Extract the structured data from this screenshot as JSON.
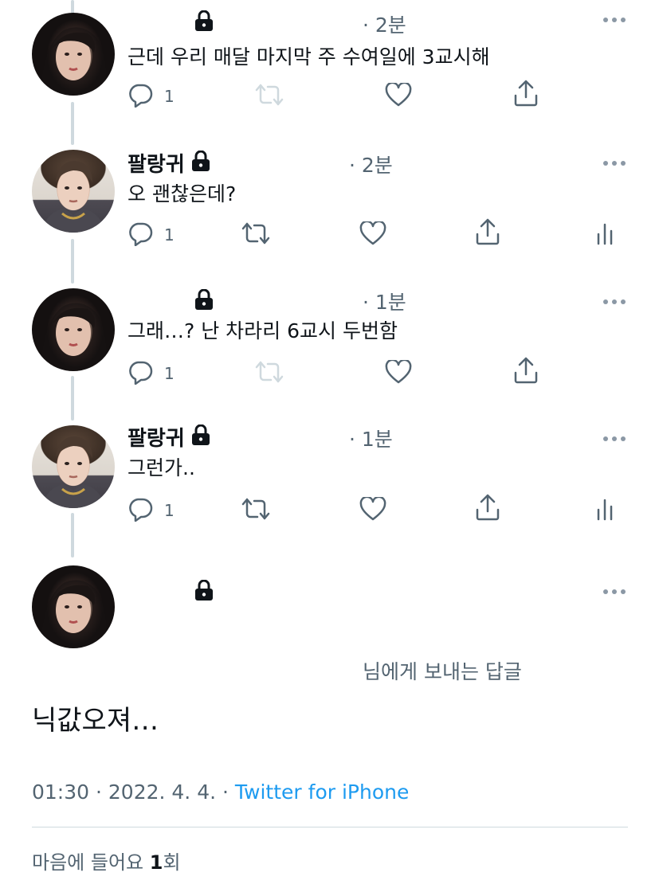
{
  "thread": [
    {
      "author": "",
      "locked": true,
      "time": "· 2분",
      "text": "근데 우리 매달 마지막 주 수여일에 3교시해",
      "reply_count": "1",
      "avatar": "girl"
    },
    {
      "author": "팔랑귀",
      "locked": true,
      "time": "· 2분",
      "text": "오 괜찮은데?",
      "reply_count": "1",
      "avatar": "boy"
    },
    {
      "author": "",
      "locked": true,
      "time": "· 1분",
      "text": "그래…? 난 차라리 6교시 두번함",
      "reply_count": "1",
      "avatar": "girl"
    },
    {
      "author": "팔랑귀",
      "locked": true,
      "time": "· 1분",
      "text": "그런가..",
      "reply_count": "1",
      "avatar": "boy"
    }
  ],
  "main_tweet": {
    "reply_to": "님에게 보내는 답글",
    "text": "닉값오져…",
    "timestamp": "01:30 · 2022. 4. 4. · ",
    "source": "Twitter for iPhone",
    "likes_label": "마음에 들어요 ",
    "likes_count": "1",
    "likes_suffix": "회"
  },
  "icons": {
    "reply": "reply-icon",
    "retweet": "retweet-icon",
    "like": "heart-icon",
    "share": "share-icon",
    "analytics": "analytics-icon",
    "more": "more-icon",
    "lock": "lock-icon"
  },
  "colors": {
    "text": "#0f1419",
    "secondary": "#536471",
    "link": "#1d9bf0",
    "divider": "#cfd9de"
  }
}
